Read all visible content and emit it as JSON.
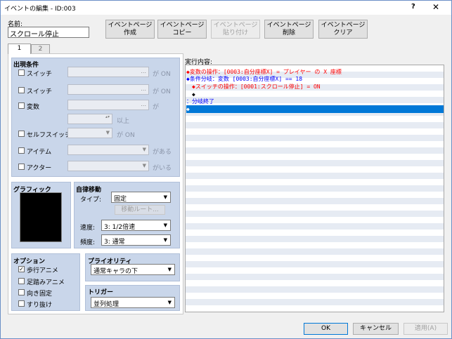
{
  "window": {
    "title": "イベントの編集 - ID:003",
    "help_label": "?",
    "close_label": "✕"
  },
  "name": {
    "label": "名前:",
    "value": "スクロール停止"
  },
  "toolbar": [
    {
      "id": "create",
      "line1": "イベントページ",
      "line2": "作成",
      "enabled": true
    },
    {
      "id": "copy",
      "line1": "イベントページ",
      "line2": "コピー",
      "enabled": true
    },
    {
      "id": "paste",
      "line1": "イベントページ",
      "line2": "貼り付け",
      "enabled": false
    },
    {
      "id": "delete",
      "line1": "イベントページ",
      "line2": "削除",
      "enabled": true
    },
    {
      "id": "clear",
      "line1": "イベントページ",
      "line2": "クリア",
      "enabled": true
    }
  ],
  "tabs": [
    "1",
    "2"
  ],
  "conditions": {
    "title": "出現条件",
    "switch1": {
      "label": "スイッチ",
      "value": "",
      "suffix": "が ON"
    },
    "switch2": {
      "label": "スイッチ",
      "value": "",
      "suffix": "が ON"
    },
    "variable": {
      "label": "変数",
      "value": "",
      "suffix": "が",
      "num": "",
      "num_suffix": "以上"
    },
    "self_switch": {
      "label": "セルフスイッチ",
      "value": "",
      "suffix": "が ON"
    },
    "item": {
      "label": "アイテム",
      "value": "",
      "suffix": "がある"
    },
    "actor": {
      "label": "アクター",
      "value": "",
      "suffix": "がいる"
    }
  },
  "graphic": {
    "title": "グラフィック"
  },
  "autonomous": {
    "title": "自律移動",
    "type_label": "タイプ:",
    "type_value": "固定",
    "route_button": "移動ルート...",
    "speed_label": "速度:",
    "speed_value": "3: 1/2倍速",
    "freq_label": "頻度:",
    "freq_value": "3: 通常"
  },
  "options": {
    "title": "オプション",
    "items": [
      {
        "label": "歩行アニメ",
        "checked": true,
        "mark": "✓"
      },
      {
        "label": "足踏みアニメ",
        "checked": false,
        "mark": ""
      },
      {
        "label": "向き固定",
        "checked": false,
        "mark": ""
      },
      {
        "label": "すり抜け",
        "checked": false,
        "mark": ""
      }
    ]
  },
  "priority": {
    "title": "プライオリティ",
    "value": "通常キャラの下"
  },
  "trigger": {
    "title": "トリガー",
    "value": "並列処理"
  },
  "contents": {
    "label": "実行内容:",
    "lines": [
      {
        "text": "◆変数の操作：[0003:自分座標X] = プレイヤー の X 座標",
        "color": "#ff0000",
        "indent": 0
      },
      {
        "text": "◆条件分岐：変数 [0003:自分座標X] == 18",
        "color": "#0000ff",
        "indent": 0
      },
      {
        "text": "◆スイッチの操作：[0001:スクロール停止] = ON",
        "color": "#ff0000",
        "indent": 1
      },
      {
        "text": "◆",
        "color": "#000000",
        "indent": 1
      },
      {
        "text": "：分岐終了",
        "color": "#0000ff",
        "indent": 0
      },
      {
        "text": "◆",
        "color": "#ffffff",
        "indent": 0
      }
    ],
    "selected_index": 5,
    "selection_color": "#0078d7"
  },
  "footer": {
    "ok": "OK",
    "cancel": "キャンセル",
    "apply": "適用(A)"
  }
}
